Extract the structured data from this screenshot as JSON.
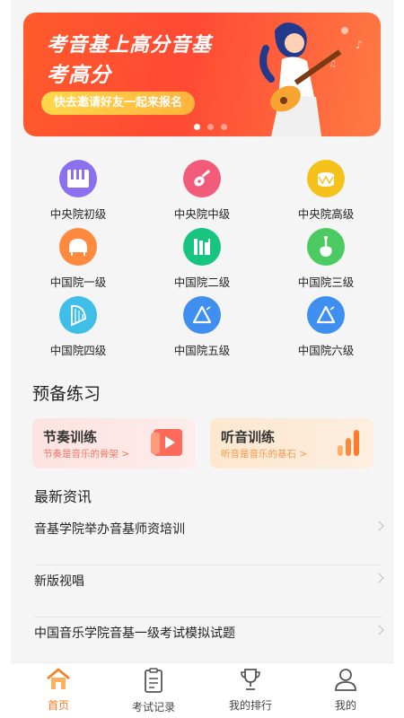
{
  "banner": {
    "line1": "考音基上高分音基",
    "line2": "考高分",
    "cta": "快去邀请好友一起来报名",
    "page_count": 3,
    "active_page": 1
  },
  "levels": [
    {
      "label": "中央院初级",
      "icon": "piano-keys-icon",
      "color": "#8b6ff0"
    },
    {
      "label": "中央院中级",
      "icon": "guitar-icon",
      "color": "#f25c7a"
    },
    {
      "label": "中央院高级",
      "icon": "drum-icon",
      "color": "#f5c21b"
    },
    {
      "label": "中国院一级",
      "icon": "grand-piano-icon",
      "color": "#ff8a3d"
    },
    {
      "label": "中国院二级",
      "icon": "xylophone-icon",
      "color": "#19c480"
    },
    {
      "label": "中国院三级",
      "icon": "electric-guitar-icon",
      "color": "#4ccb63"
    },
    {
      "label": "中国院四级",
      "icon": "harp-icon",
      "color": "#3fbfe8"
    },
    {
      "label": "中国院五级",
      "icon": "triangle-icon",
      "color": "#3f8ff0"
    },
    {
      "label": "中国院六级",
      "icon": "triangle-icon",
      "color": "#3f8ff0"
    }
  ],
  "practice": {
    "title": "预备练习",
    "cards": [
      {
        "title": "节奏训练",
        "subtitle": "节奏是音乐的骨架 >",
        "icon": "play-video-icon",
        "bg": "#fde6e4",
        "accent": "#ff6a5a"
      },
      {
        "title": "听音训练",
        "subtitle": "听音是音乐的基石 >",
        "icon": "bar-chart-icon",
        "bg": "#fdecd9",
        "accent": "#ff8a3d"
      }
    ]
  },
  "news": {
    "title": "最新资讯",
    "items": [
      "音基学院举办音基师资培训",
      "新版视唱",
      "中国音乐学院音基一级考试模拟试题"
    ]
  },
  "tabs": [
    {
      "label": "首页",
      "icon": "home-icon",
      "active": true
    },
    {
      "label": "考试记录",
      "icon": "clipboard-icon",
      "active": false
    },
    {
      "label": "我的排行",
      "icon": "trophy-icon",
      "active": false
    },
    {
      "label": "我的",
      "icon": "user-icon",
      "active": false
    }
  ],
  "colors": {
    "accent": "#ff7a1a",
    "banner": "#ff4a34"
  }
}
